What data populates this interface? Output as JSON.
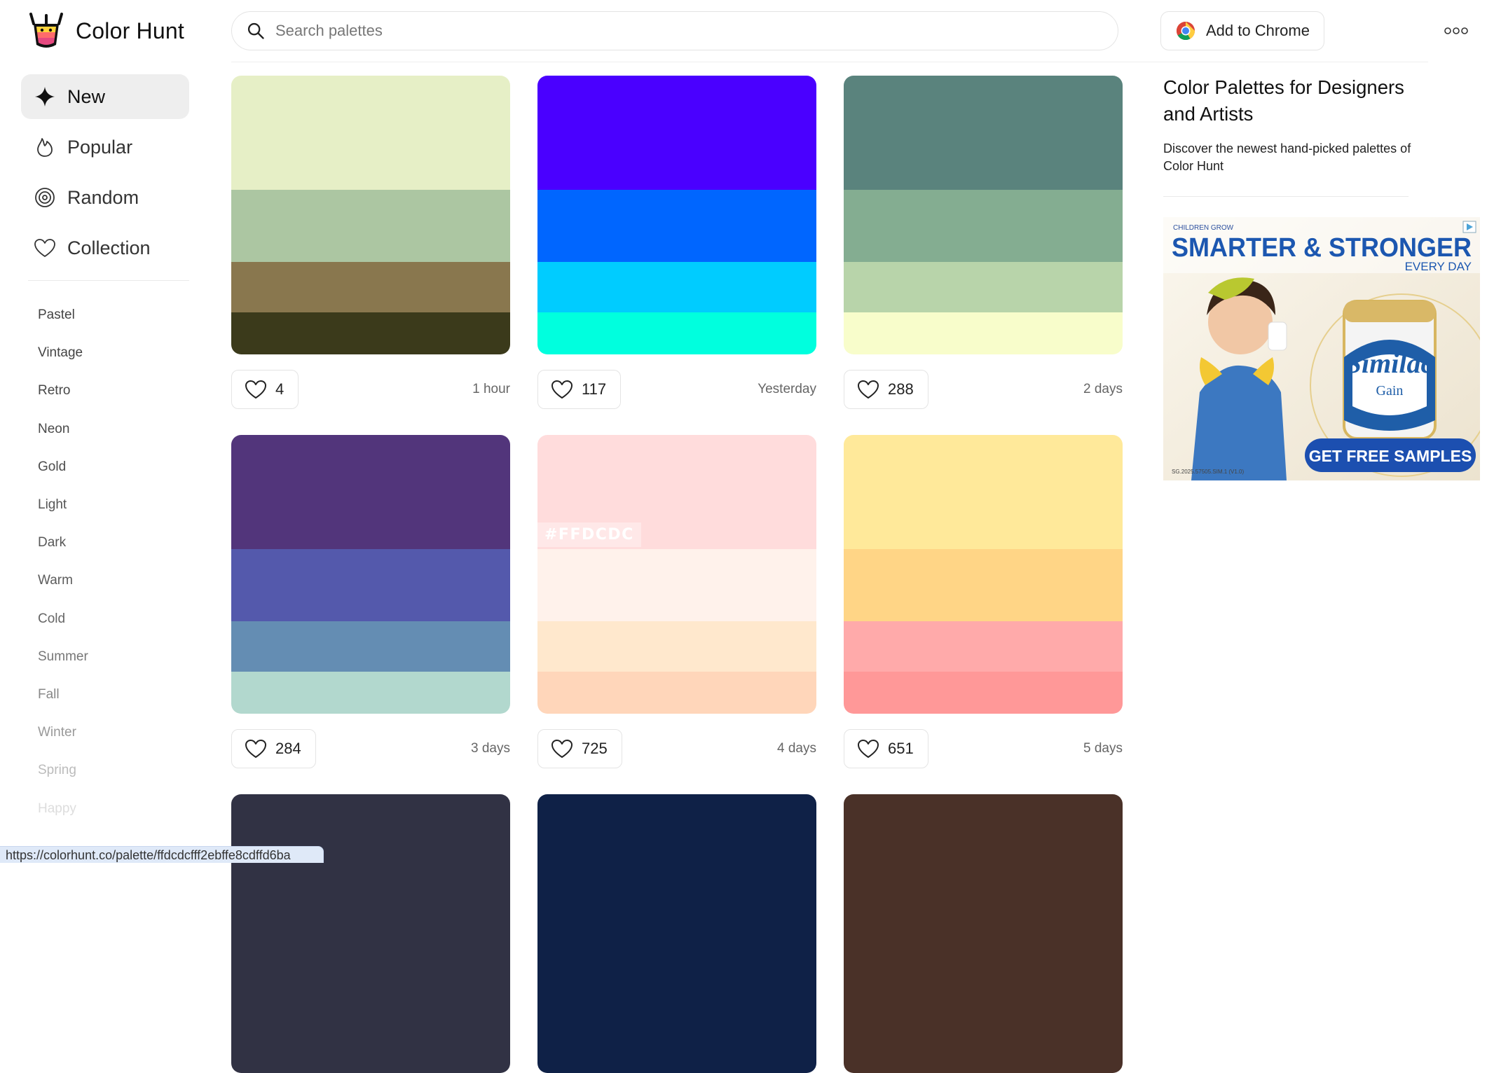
{
  "header": {
    "brand": "Color Hunt",
    "search_placeholder": "Search palettes",
    "chrome_label": "Add to Chrome"
  },
  "sidebar": {
    "nav": [
      {
        "label": "New",
        "icon": "sparkle-icon",
        "active": true
      },
      {
        "label": "Popular",
        "icon": "flame-icon"
      },
      {
        "label": "Random",
        "icon": "spiral-icon"
      },
      {
        "label": "Collection",
        "icon": "heart-icon"
      }
    ],
    "tags": [
      "Pastel",
      "Vintage",
      "Retro",
      "Neon",
      "Gold",
      "Light",
      "Dark",
      "Warm",
      "Cold",
      "Summer",
      "Fall",
      "Winter",
      "Spring",
      "Happy"
    ]
  },
  "palettes": [
    {
      "colors": [
        "#E6EFC6",
        "#ACC6A2",
        "#89774E",
        "#3B3A1B"
      ],
      "likes": "4",
      "time": "1 hour"
    },
    {
      "colors": [
        "#4A00FF",
        "#0066FF",
        "#00CCFF",
        "#00FFDE"
      ],
      "likes": "117",
      "time": "Yesterday"
    },
    {
      "colors": [
        "#5A837D",
        "#84AD91",
        "#B8D4AA",
        "#F8FDCB"
      ],
      "likes": "288",
      "time": "2 days"
    },
    {
      "colors": [
        "#52357B",
        "#5459AC",
        "#648DB3",
        "#B2D8CE"
      ],
      "likes": "284",
      "time": "3 days"
    },
    {
      "colors": [
        "#FFDCDC",
        "#FFF2EB",
        "#FFE8CD",
        "#FFD6BA"
      ],
      "likes": "725",
      "time": "4 days",
      "hover_label": "#FFDCDC"
    },
    {
      "colors": [
        "#FFE99A",
        "#FFD586",
        "#FFAAAA",
        "#FF9898"
      ],
      "likes": "651",
      "time": "5 days"
    },
    {
      "colors": [
        "#313244"
      ]
    },
    {
      "colors": [
        "#0F2147"
      ]
    },
    {
      "colors": [
        "#4A3128"
      ]
    }
  ],
  "intro": {
    "title": "Color Palettes for Designers and Artists",
    "text": "Discover the newest hand-picked palettes of Color Hunt"
  },
  "ad": {
    "tagline": "CHILDREN GROW",
    "headline": "SMARTER & STRONGER",
    "subline": "EVERY DAY",
    "brand": "Similac",
    "product": "Gain",
    "cta": "GET FREE SAMPLES",
    "small_print": "SG.2025.57505.SIM.1 (V1.0)"
  },
  "status_url": "https://colorhunt.co/palette/ffdcdcfff2ebffe8cdffd6ba"
}
